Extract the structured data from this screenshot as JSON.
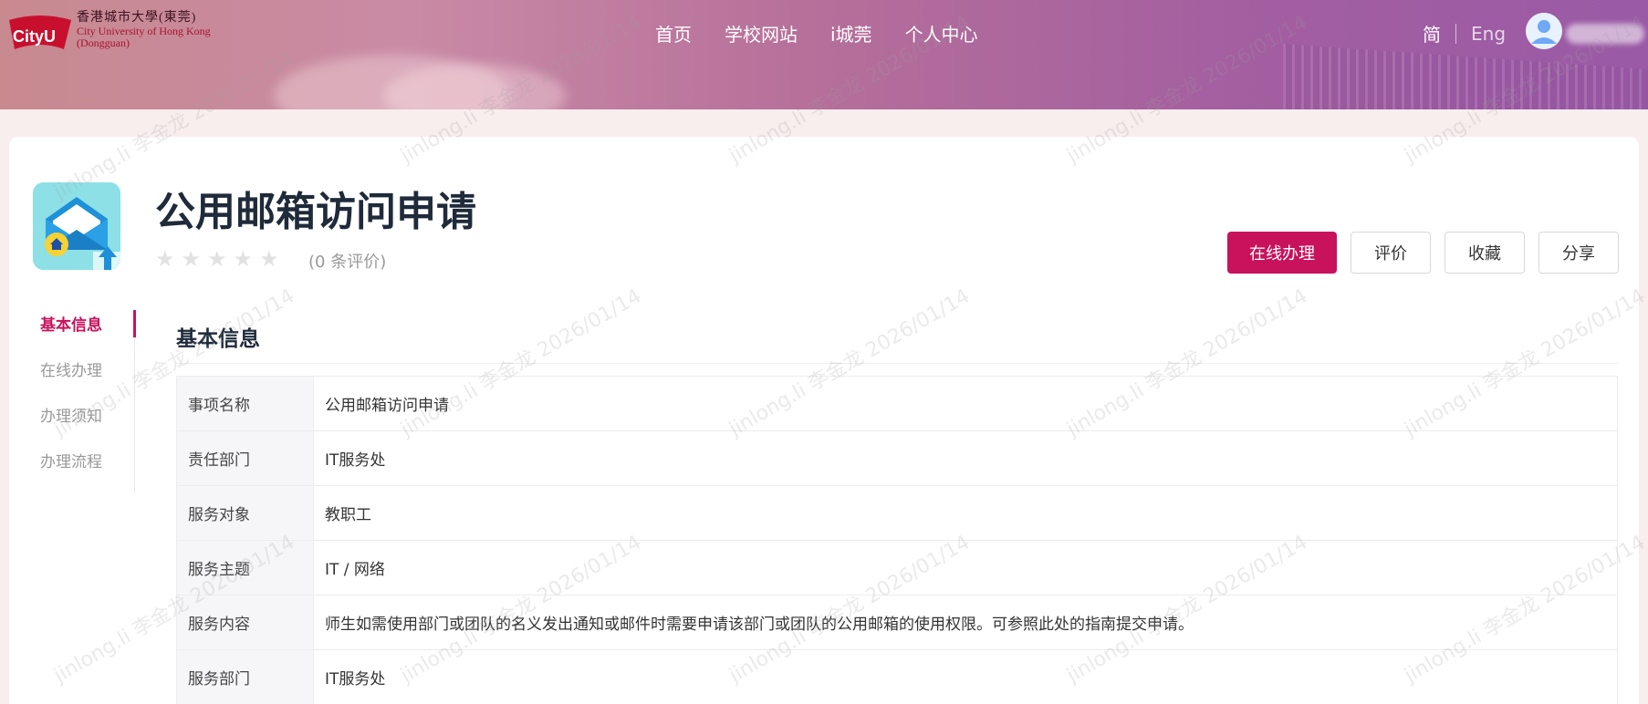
{
  "header": {
    "logo": {
      "mark_text": "CityU",
      "name_cn": "香港城市大學(東莞)",
      "name_en_line1": "City University of Hong Kong",
      "name_en_line2": "(Dongguan)"
    },
    "nav": [
      {
        "label": "首页"
      },
      {
        "label": "学校网站"
      },
      {
        "label": "i城莞"
      },
      {
        "label": "个人中心"
      }
    ],
    "lang": {
      "zh": "简",
      "en": "Eng"
    }
  },
  "service": {
    "icon": "envelope-upload-icon",
    "title": "公用邮箱访问申请",
    "rating": {
      "stars": 0,
      "max": 5,
      "count_text": "(0 条评价)"
    },
    "actions": {
      "online": "在线办理",
      "review": "评价",
      "favorite": "收藏",
      "share": "分享"
    }
  },
  "sidenav": [
    {
      "label": "基本信息",
      "active": true
    },
    {
      "label": "在线办理",
      "active": false
    },
    {
      "label": "办理须知",
      "active": false
    },
    {
      "label": "办理流程",
      "active": false
    }
  ],
  "basic_info": {
    "heading": "基本信息",
    "rows": [
      {
        "key": "事项名称",
        "value": "公用邮箱访问申请"
      },
      {
        "key": "责任部门",
        "value": "IT服务处"
      },
      {
        "key": "服务对象",
        "value": "教职工"
      },
      {
        "key": "服务主题",
        "value": "IT / 网络"
      },
      {
        "key": "服务内容",
        "value": "师生如需使用部门或团队的名义发出通知或邮件时需要申请该部门或团队的公用邮箱的使用权限。可参照此处的指南提交申请。"
      },
      {
        "key": "服务部门",
        "value": "IT服务处"
      }
    ]
  },
  "watermark_text": "jinlong.li 李金龙 2026/01/14",
  "colors": {
    "accent": "#c8125c",
    "header_start": "#c88a8f",
    "header_end": "#9a5aa6"
  }
}
